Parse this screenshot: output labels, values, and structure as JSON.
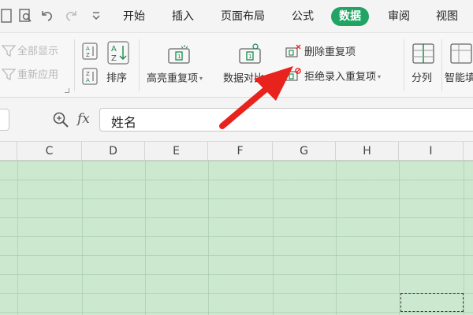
{
  "menubar": {
    "tabs": [
      {
        "label": "开始"
      },
      {
        "label": "插入"
      },
      {
        "label": "页面布局"
      },
      {
        "label": "公式"
      },
      {
        "label": "数据"
      },
      {
        "label": "审阅"
      },
      {
        "label": "视图"
      }
    ],
    "active_tab": "数据",
    "active_color": "#21a464"
  },
  "ribbon": {
    "show_all": "全部显示",
    "reapply": "重新应用",
    "sort": "排序",
    "highlight_duplicates": "高亮重复项",
    "data_compare": "数据对比",
    "delete_duplicates": "删除重复项",
    "reject_duplicates": "拒绝录入重复项",
    "split_column": "分列",
    "smart": "智能填"
  },
  "formula_bar": {
    "fx_label": "fx",
    "content": "姓名"
  },
  "columns": [
    "C",
    "D",
    "E",
    "F",
    "G",
    "H",
    "I"
  ],
  "colors": {
    "grid_fill": "#cce8cf",
    "arrow": "#e8231d"
  }
}
